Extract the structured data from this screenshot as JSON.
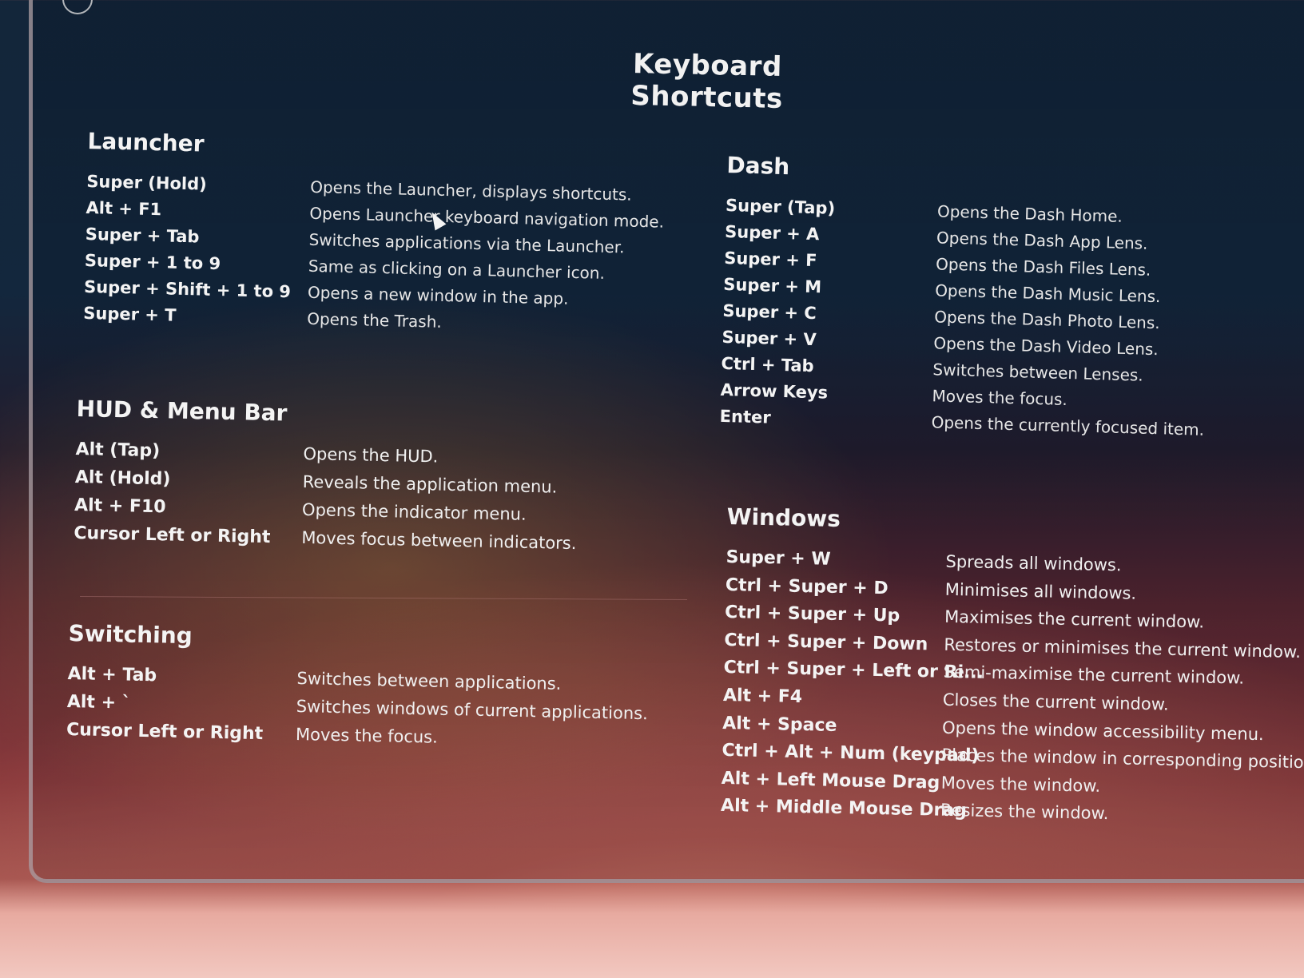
{
  "title": "Keyboard Shortcuts",
  "launcher": {
    "header": "Launcher",
    "items": [
      {
        "key": "Super (Hold)",
        "desc": "Opens the Launcher, displays shortcuts."
      },
      {
        "key": "Alt + F1",
        "desc": "Opens Launcher keyboard navigation mode."
      },
      {
        "key": "Super + Tab",
        "desc": "Switches applications via the Launcher."
      },
      {
        "key": "Super + 1 to 9",
        "desc": "Same as clicking on a Launcher icon."
      },
      {
        "key": "Super + Shift + 1 to 9",
        "desc": "Opens a new window in the app."
      },
      {
        "key": "Super + T",
        "desc": "Opens the Trash."
      }
    ]
  },
  "hud": {
    "header": "HUD & Menu Bar",
    "items": [
      {
        "key": "Alt (Tap)",
        "desc": "Opens the HUD."
      },
      {
        "key": "Alt (Hold)",
        "desc": "Reveals the application menu."
      },
      {
        "key": "Alt + F10",
        "desc": "Opens the indicator menu."
      },
      {
        "key": "Cursor Left or Right",
        "desc": "Moves focus between indicators."
      }
    ]
  },
  "switching": {
    "header": "Switching",
    "items": [
      {
        "key": "Alt + Tab",
        "desc": "Switches between applications."
      },
      {
        "key": "Alt + `",
        "desc": "Switches windows of current applications."
      },
      {
        "key": "Cursor Left or Right",
        "desc": "Moves the focus."
      }
    ]
  },
  "dash": {
    "header": "Dash",
    "items": [
      {
        "key": "Super (Tap)",
        "desc": "Opens the Dash Home."
      },
      {
        "key": "Super + A",
        "desc": "Opens the Dash App Lens."
      },
      {
        "key": "Super + F",
        "desc": "Opens the Dash Files Lens."
      },
      {
        "key": "Super + M",
        "desc": "Opens the Dash Music Lens."
      },
      {
        "key": "Super + C",
        "desc": "Opens the Dash Photo Lens."
      },
      {
        "key": "Super + V",
        "desc": "Opens the Dash Video Lens."
      },
      {
        "key": "Ctrl + Tab",
        "desc": "Switches between Lenses."
      },
      {
        "key": "Arrow Keys",
        "desc": "Moves the focus."
      },
      {
        "key": "Enter",
        "desc": "Opens the currently focused item."
      }
    ]
  },
  "windows": {
    "header": "Windows",
    "items": [
      {
        "key": "Super + W",
        "desc": "Spreads all windows."
      },
      {
        "key": "Ctrl + Super + D",
        "desc": "Minimises all windows."
      },
      {
        "key": "Ctrl + Super + Up",
        "desc": "Maximises the current window."
      },
      {
        "key": "Ctrl + Super + Down",
        "desc": "Restores or minimises the current window."
      },
      {
        "key": "Ctrl + Super + Left or Ri...",
        "desc": "Semi-maximise the current window."
      },
      {
        "key": "Alt + F4",
        "desc": "Closes the current window."
      },
      {
        "key": "Alt + Space",
        "desc": "Opens the window accessibility menu."
      },
      {
        "key": "Ctrl + Alt + Num (keypad)",
        "desc": "Places the window in corresponding position."
      },
      {
        "key": "Alt + Left Mouse Drag",
        "desc": "Moves the window."
      },
      {
        "key": "Alt + Middle Mouse Drag",
        "desc": "Resizes the window."
      }
    ]
  }
}
